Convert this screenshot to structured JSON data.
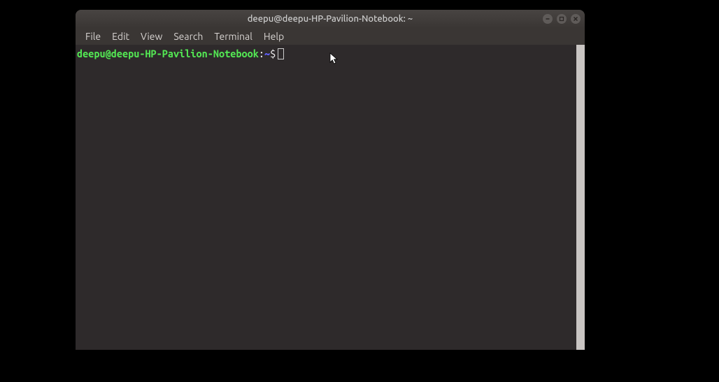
{
  "titlebar": {
    "title": "deepu@deepu-HP-Pavilion-Notebook: ~"
  },
  "menubar": {
    "items": [
      "File",
      "Edit",
      "View",
      "Search",
      "Terminal",
      "Help"
    ]
  },
  "prompt": {
    "userhost": "deepu@deepu-HP-Pavilion-Notebook",
    "colon": ":",
    "cwd": "~",
    "symbol": "$"
  }
}
